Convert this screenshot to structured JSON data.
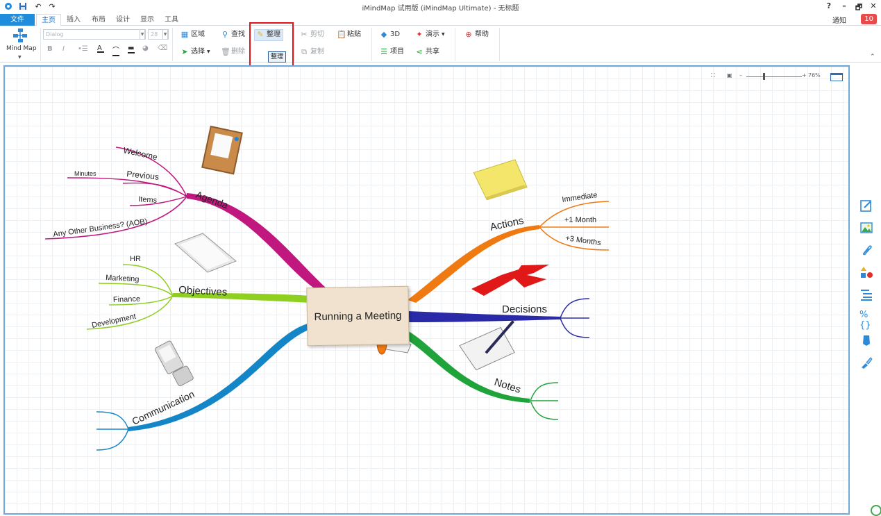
{
  "window": {
    "title": "iMindMap 试用版 (iMindMap Ultimate) - 无标题"
  },
  "title_controls": {
    "help": "?",
    "minimize": "–",
    "restore": "🗗",
    "close": "✕"
  },
  "menu": {
    "tabs": [
      "文件",
      "主页",
      "插入",
      "布局",
      "设计",
      "显示",
      "工具"
    ],
    "notify_label": "通知",
    "notify_count": "10"
  },
  "ribbon": {
    "mindmap_label": "Mind Map",
    "font_name": "Dialog",
    "font_size": "28",
    "area": "区域",
    "select": "选择",
    "find": "查找",
    "delete": "删除",
    "tidy": "整理",
    "tidy_tooltip": "整理",
    "cut": "剪切",
    "paste": "粘贴",
    "copy": "复制",
    "three_d": "3D",
    "project": "项目",
    "present": "演示",
    "share": "共享",
    "help": "帮助"
  },
  "zoom": {
    "value": "76%"
  },
  "mindmap": {
    "central": "Running a Meeting",
    "branches": {
      "agenda": "Agenda",
      "objectives": "Objectives",
      "communication": "Communication",
      "actions": "Actions",
      "decisions": "Decisions",
      "notes": "Notes"
    },
    "agenda_items": {
      "welcome": "Welcome",
      "minutes": "Minutes",
      "previous": "Previous",
      "items": "Items",
      "aob": "Any Other Business? (AOB)"
    },
    "objective_items": {
      "hr": "HR",
      "marketing": "Marketing",
      "finance": "Finance",
      "development": "Development"
    },
    "action_items": {
      "immediate": "Immediate",
      "one_month": "+1 Month",
      "three_months": "+3 Months"
    },
    "colors": {
      "agenda": "#c0187f",
      "objectives": "#8fcf1f",
      "communication": "#1486c8",
      "actions": "#f07a12",
      "decisions": "#2a2aa8",
      "notes": "#1fa33a"
    }
  }
}
